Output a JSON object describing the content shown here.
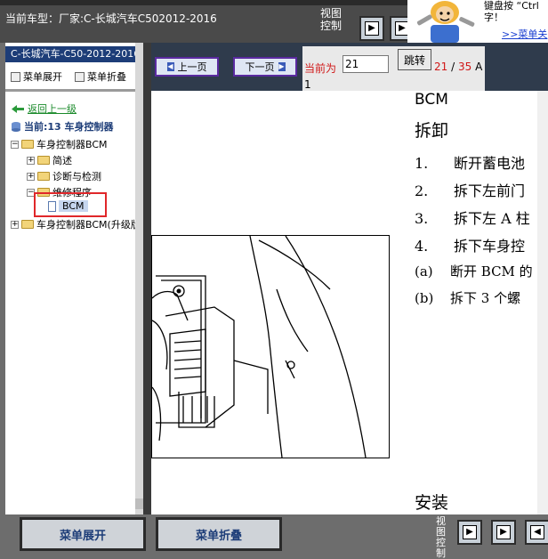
{
  "header": {
    "vehicle_label": "当前车型：厂家:C-长城汽车C502012-2016",
    "view_control_label": "视图控制",
    "nav_first": "▶▏",
    "nav_second": "▶◀"
  },
  "tip": {
    "text_line1": "键盘按 “Ctrl",
    "text_line2": "字！",
    "link": ">>菜单关"
  },
  "sidebar": {
    "title": "C-长城汽车-C50-2012-2016",
    "expand_label": "菜单展开",
    "collapse_label": "菜单折叠",
    "back_label": "返回上一级",
    "current_label": "当前:13 车身控制器",
    "tree": [
      {
        "label": "车身控制器BCM",
        "level": 0,
        "toggle": "−"
      },
      {
        "label": "简述",
        "level": 1,
        "toggle": "+"
      },
      {
        "label": "诊断与检测",
        "level": 1,
        "toggle": "+"
      },
      {
        "label": "维修程序",
        "level": 1,
        "toggle": "−"
      },
      {
        "label": "BCM",
        "level": 2,
        "selected": true
      },
      {
        "label": "车身控制器BCM(升级版",
        "level": 0,
        "toggle": "+"
      }
    ]
  },
  "toolbar": {
    "prev_label": "上一页",
    "next_label": "下一页",
    "current_page_label": "当前为",
    "page_value": "21",
    "jump_label": "跳转",
    "page_current": "21",
    "page_total": "35",
    "page_suffix": "A",
    "page_extra": "1"
  },
  "document": {
    "title": "BCM",
    "section": "拆卸",
    "steps": [
      {
        "num": "1.",
        "text": "断开蓄电池"
      },
      {
        "num": "2.",
        "text": "拆下左前门"
      },
      {
        "num": "3.",
        "text": "拆下左 A 柱"
      },
      {
        "num": "4.",
        "text": "拆下车身控"
      }
    ],
    "substeps": [
      {
        "num": "(a)",
        "text": "断开 BCM 的"
      },
      {
        "num": "(b)",
        "text": "拆下 3 个螺"
      }
    ],
    "section2": "安装"
  },
  "bottom": {
    "expand_label": "菜单展开",
    "collapse_label": "菜单折叠",
    "view_control_label": "视图控制"
  },
  "colors": {
    "sidebar_title_bg": "#1d3d78",
    "highlight_border": "#e0272a",
    "page_number_red": "#d01818",
    "link_green": "#1a8a2a"
  }
}
